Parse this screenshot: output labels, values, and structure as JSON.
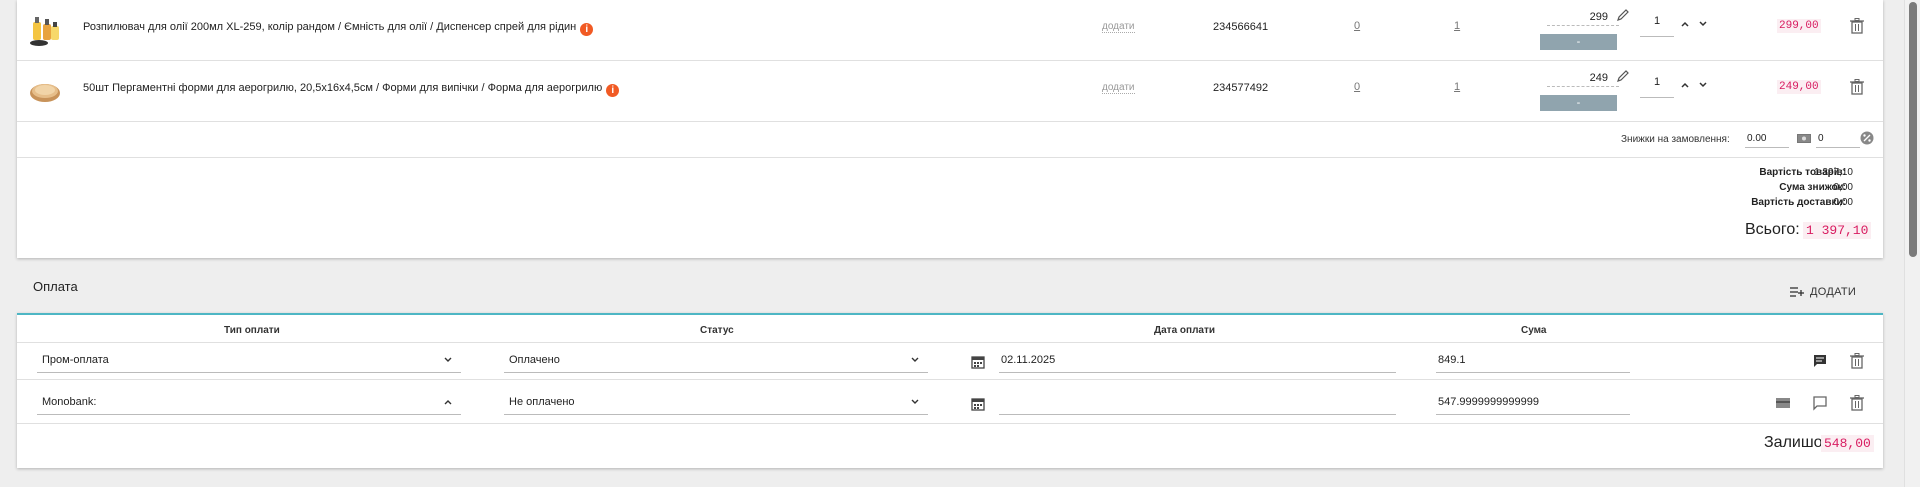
{
  "products": [
    {
      "name": "Розпилювач для олії 200мл XL-259, колір рандом / Ємність для олії / Диспенсер спрей для рідин",
      "add_label": "додати",
      "sku": "234566641",
      "link_a": "0",
      "link_b": "1",
      "price": "299",
      "price_btn": "-",
      "qty": "1",
      "total": "299,00",
      "thumb_icon": "oil-sprayer-image"
    },
    {
      "name": "50шт Пергаментні форми для аерогрилю, 20,5х16х4,5см / Форми для випічки / Форма для аерогрилю",
      "add_label": "додати",
      "sku": "234577492",
      "link_a": "0",
      "link_b": "1",
      "price": "249",
      "price_btn": "-",
      "qty": "1",
      "total": "249,00",
      "thumb_icon": "parchment-form-image"
    }
  ],
  "discounts": {
    "label": "Знижки на замовлення:",
    "amount": "0.00",
    "percent": "0"
  },
  "summary": {
    "goods_label": "Вартість товарів:",
    "goods_value": "1 397,10",
    "discount_label": "Сума знижок:",
    "discount_value": "0,00",
    "delivery_label": "Вартість доставки:",
    "delivery_value": "0,00",
    "total_label": "Всього:",
    "total_value": "1 397,10"
  },
  "payments": {
    "title": "Оплата",
    "add_label": "ДОДАТИ",
    "headers": {
      "type": "Тип оплати",
      "status": "Статус",
      "date": "Дата оплати",
      "amount": "Сума"
    },
    "rows": [
      {
        "type": "Пром-оплата",
        "status": "Оплачено",
        "date": "02.11.2025",
        "amount": "849.1"
      },
      {
        "type": "Monobank:",
        "status": "Не оплачено",
        "date": "",
        "amount": "547.9999999999999"
      }
    ],
    "remainder_label": "Залишок:",
    "remainder_value": "548,00"
  },
  "colors": {
    "accent_teal": "#4db6c4",
    "price_red": "#d81b60",
    "info_orange": "#f15a24",
    "grey_button": "#90a4ae"
  }
}
